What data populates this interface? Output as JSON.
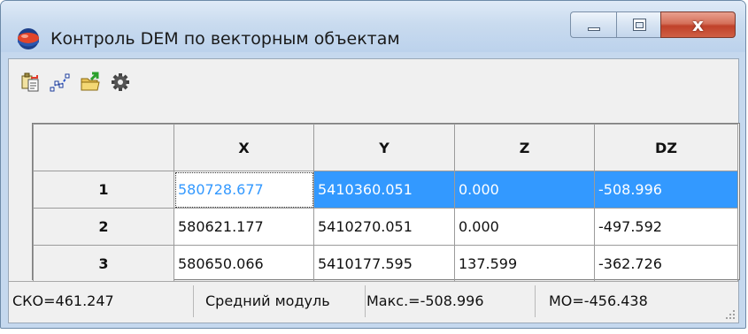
{
  "window": {
    "title": "Контроль DEM по векторным объектам",
    "close_glyph": "x"
  },
  "toolbar": {
    "items": [
      {
        "name": "copy-to-clipboard-icon"
      },
      {
        "name": "vector-objects-icon"
      },
      {
        "name": "export-folder-icon"
      },
      {
        "name": "settings-gear-icon"
      }
    ]
  },
  "table": {
    "columns": [
      "",
      "X",
      "Y",
      "Z",
      "DZ"
    ],
    "rows": [
      {
        "num": "1",
        "x": "580728.677",
        "y": "5410360.051",
        "z": "0.000",
        "dz": "-508.996",
        "selected": true
      },
      {
        "num": "2",
        "x": "580621.177",
        "y": "5410270.051",
        "z": "0.000",
        "dz": "-497.592",
        "selected": false
      },
      {
        "num": "3",
        "x": "580650.066",
        "y": "5410177.595",
        "z": "137.599",
        "dz": "-362.726",
        "selected": false
      }
    ]
  },
  "status": {
    "sko": "СКО=461.247",
    "mean_abs": "Средний модуль",
    "max": "Макс.=-508.996",
    "mo": "МО=-456.438"
  },
  "colors": {
    "selection": "#3399ff",
    "close_button": "#c0412a"
  }
}
